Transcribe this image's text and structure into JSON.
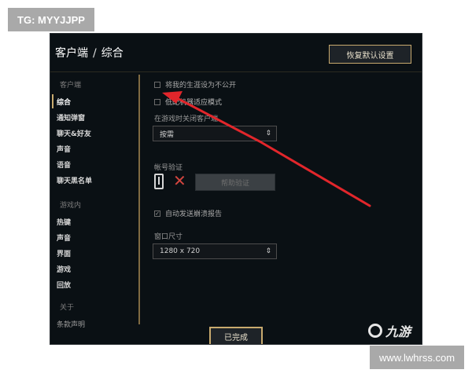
{
  "watermarks": {
    "top_left": "TG: MYYJJPP",
    "bottom_right": "www.lwhrss.com"
  },
  "header": {
    "breadcrumb": [
      "客户端",
      "综合"
    ],
    "breadcrumb_separator": "/",
    "reset_button": "恢复默认设置"
  },
  "sidebar": {
    "groups": [
      {
        "label": "客户端",
        "items": [
          "综合",
          "通知弹窗",
          "聊天&好友",
          "声音",
          "语音",
          "聊天黑名单"
        ]
      },
      {
        "label": "游戏内",
        "items": [
          "热键",
          "声音",
          "界面",
          "游戏",
          "回放"
        ]
      },
      {
        "label": "关于",
        "items": [
          "条款声明"
        ]
      }
    ],
    "active_item": "综合"
  },
  "main": {
    "opt_privacy": {
      "label": "将我的生涯设为不公开",
      "checked": false
    },
    "opt_low_spec": {
      "label": "低配机器适应模式",
      "checked": false
    },
    "close_client_label": "在游戏时关闭客户端",
    "close_client_select": "按需",
    "verify_label": "帐号验证",
    "verify_button": "帮助验证",
    "crash_report": {
      "label": "自动发送崩溃报告",
      "checked": true
    },
    "window_size_label": "窗口尺寸",
    "window_size_select": "1280 x 720"
  },
  "footer": {
    "done_button": "已完成"
  },
  "logo": {
    "text": "九游"
  },
  "icons": {
    "chevron": "chevron-updown-icon",
    "phone": "phone-icon",
    "fail": "x-icon",
    "check": "check-icon"
  },
  "colors": {
    "gold": "#c8aa6e",
    "red": "#d2453f",
    "arrow": "#e2262b",
    "bg": "#0a1014"
  }
}
